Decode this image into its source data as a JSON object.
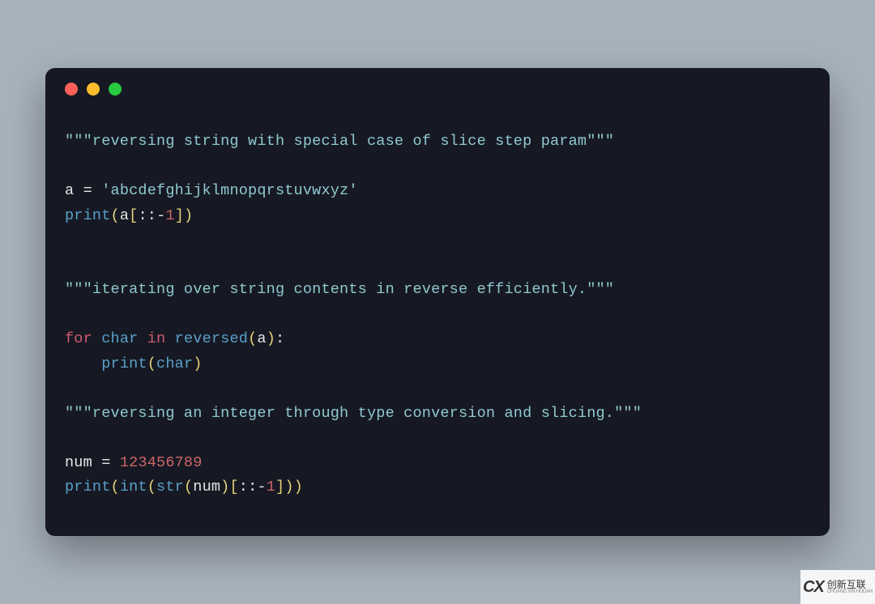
{
  "code": {
    "l1_docstring": "\"\"\"reversing string with special case of slice step param\"\"\"",
    "l3_var": "a",
    "l3_eq": " = ",
    "l3_str": "'abcdefghijklmnopqrstuvwxyz'",
    "l4_fn": "print",
    "l4_p1": "(",
    "l4_a": "a",
    "l4_b1": "[",
    "l4_colon1": ":",
    "l4_colon2": ":",
    "l4_neg": "-",
    "l4_one": "1",
    "l4_b2": "]",
    "l4_p2": ")",
    "l7_docstring": "\"\"\"iterating over string contents in reverse efficiently.\"\"\"",
    "l9_for": "for",
    "l9_char": "char",
    "l9_in": "in",
    "l9_rev": "reversed",
    "l9_p1": "(",
    "l9_a": "a",
    "l9_p2": ")",
    "l9_colon_end": ":",
    "l10_indent": "    ",
    "l10_print": "print",
    "l10_p1": "(",
    "l10_char": "char",
    "l10_p2": ")",
    "l12_docstring": "\"\"\"reversing an integer through type conversion and slicing.\"\"\"",
    "l14_var": "num",
    "l14_eq": " = ",
    "l14_num": "123456789",
    "l15_print": "print",
    "l15_p1": "(",
    "l15_int": "int",
    "l15_p2": "(",
    "l15_str": "str",
    "l15_p3": "(",
    "l15_numvar": "num",
    "l15_p4": ")",
    "l15_b1": "[",
    "l15_c1": ":",
    "l15_c2": ":",
    "l15_neg": "-",
    "l15_one": "1",
    "l15_b2": "]",
    "l15_p5": ")",
    "l15_p6": ")"
  },
  "watermark": {
    "logo": "CX",
    "cn": "创新互联",
    "en": "CHUANG XIN HULIAN"
  }
}
